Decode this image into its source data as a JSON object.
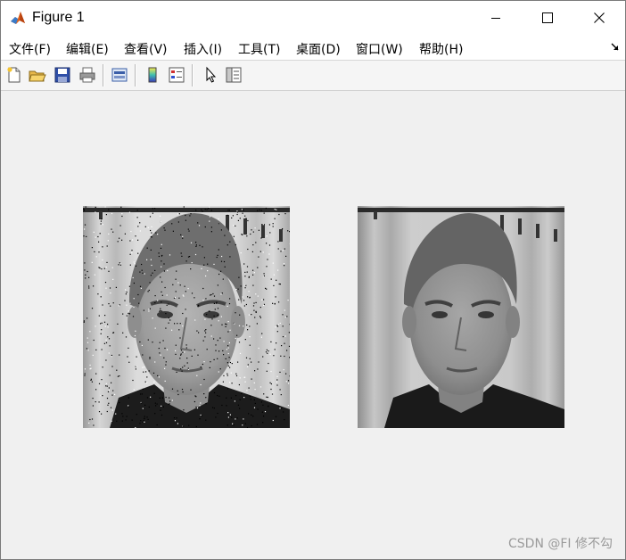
{
  "window": {
    "title": "Figure 1",
    "minimize_icon": "minimize-icon",
    "maximize_icon": "maximize-icon",
    "close_icon": "close-icon"
  },
  "menubar": {
    "items": [
      "文件(F)",
      "编辑(E)",
      "查看(V)",
      "插入(I)",
      "工具(T)",
      "桌面(D)",
      "窗口(W)",
      "帮助(H)"
    ]
  },
  "toolbar": {
    "buttons": [
      "new-figure-icon",
      "open-file-icon",
      "save-icon",
      "print-icon",
      "link-plot-icon",
      "colorbar-icon",
      "legend-icon",
      "pointer-icon",
      "property-inspector-icon"
    ]
  },
  "figure": {
    "images": [
      {
        "name": "noisy-image",
        "description_hidden": true,
        "noise": "salt-and-pepper"
      },
      {
        "name": "filtered-image",
        "description_hidden": true,
        "noise": "none"
      }
    ]
  },
  "watermark": "CSDN @FI 修不勾",
  "colors": {
    "window_bg": "#f0f0f0",
    "titlebar_bg": "#ffffff",
    "toolbar_bg": "#f5f5f5"
  }
}
